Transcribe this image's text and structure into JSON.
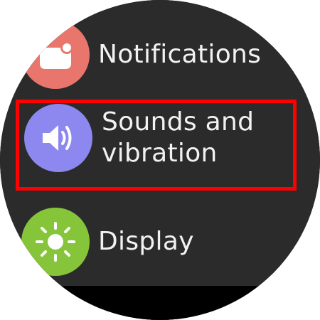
{
  "menu": {
    "items": [
      {
        "label": "Notifications",
        "icon": "notifications-icon",
        "color": "#e8766c"
      },
      {
        "label": "Sounds and vibration",
        "icon": "speaker-icon",
        "color": "#8c88f0"
      },
      {
        "label": "Display",
        "icon": "sun-icon",
        "color": "#86c43a"
      }
    ],
    "highlight_color": "#ff0000"
  }
}
